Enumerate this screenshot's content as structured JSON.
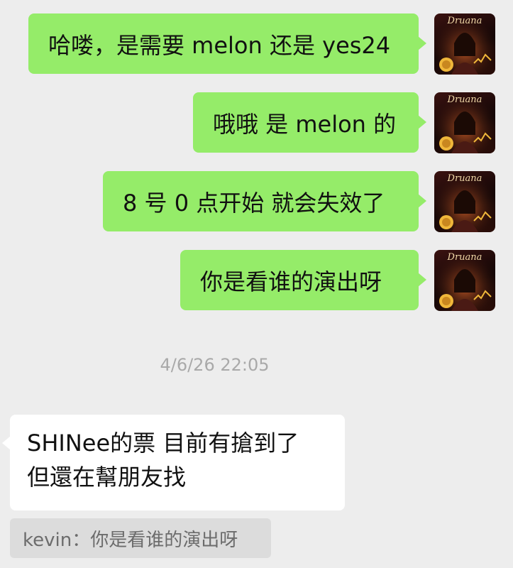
{
  "messages_out": [
    {
      "text": "哈喽，是需要 melon 还是 yes24"
    },
    {
      "text": "哦哦 是 melon 的"
    },
    {
      "text": "8 号 0 点开始 就会失效了"
    },
    {
      "text": "你是看谁的演出呀"
    }
  ],
  "avatar": {
    "label": "Druana"
  },
  "timestamp": "4/6/26 22:05",
  "message_in": {
    "line1": "SHINee的票 目前有搶到了",
    "line2": "但還在幫朋友找"
  },
  "quote": {
    "text": "kevin：你是看谁的演出呀"
  },
  "colors": {
    "background": "#ededed",
    "bubble_out": "#95ec69",
    "bubble_in": "#ffffff",
    "quote_bg": "#dcdcdc",
    "timestamp": "#a9a9a9"
  }
}
